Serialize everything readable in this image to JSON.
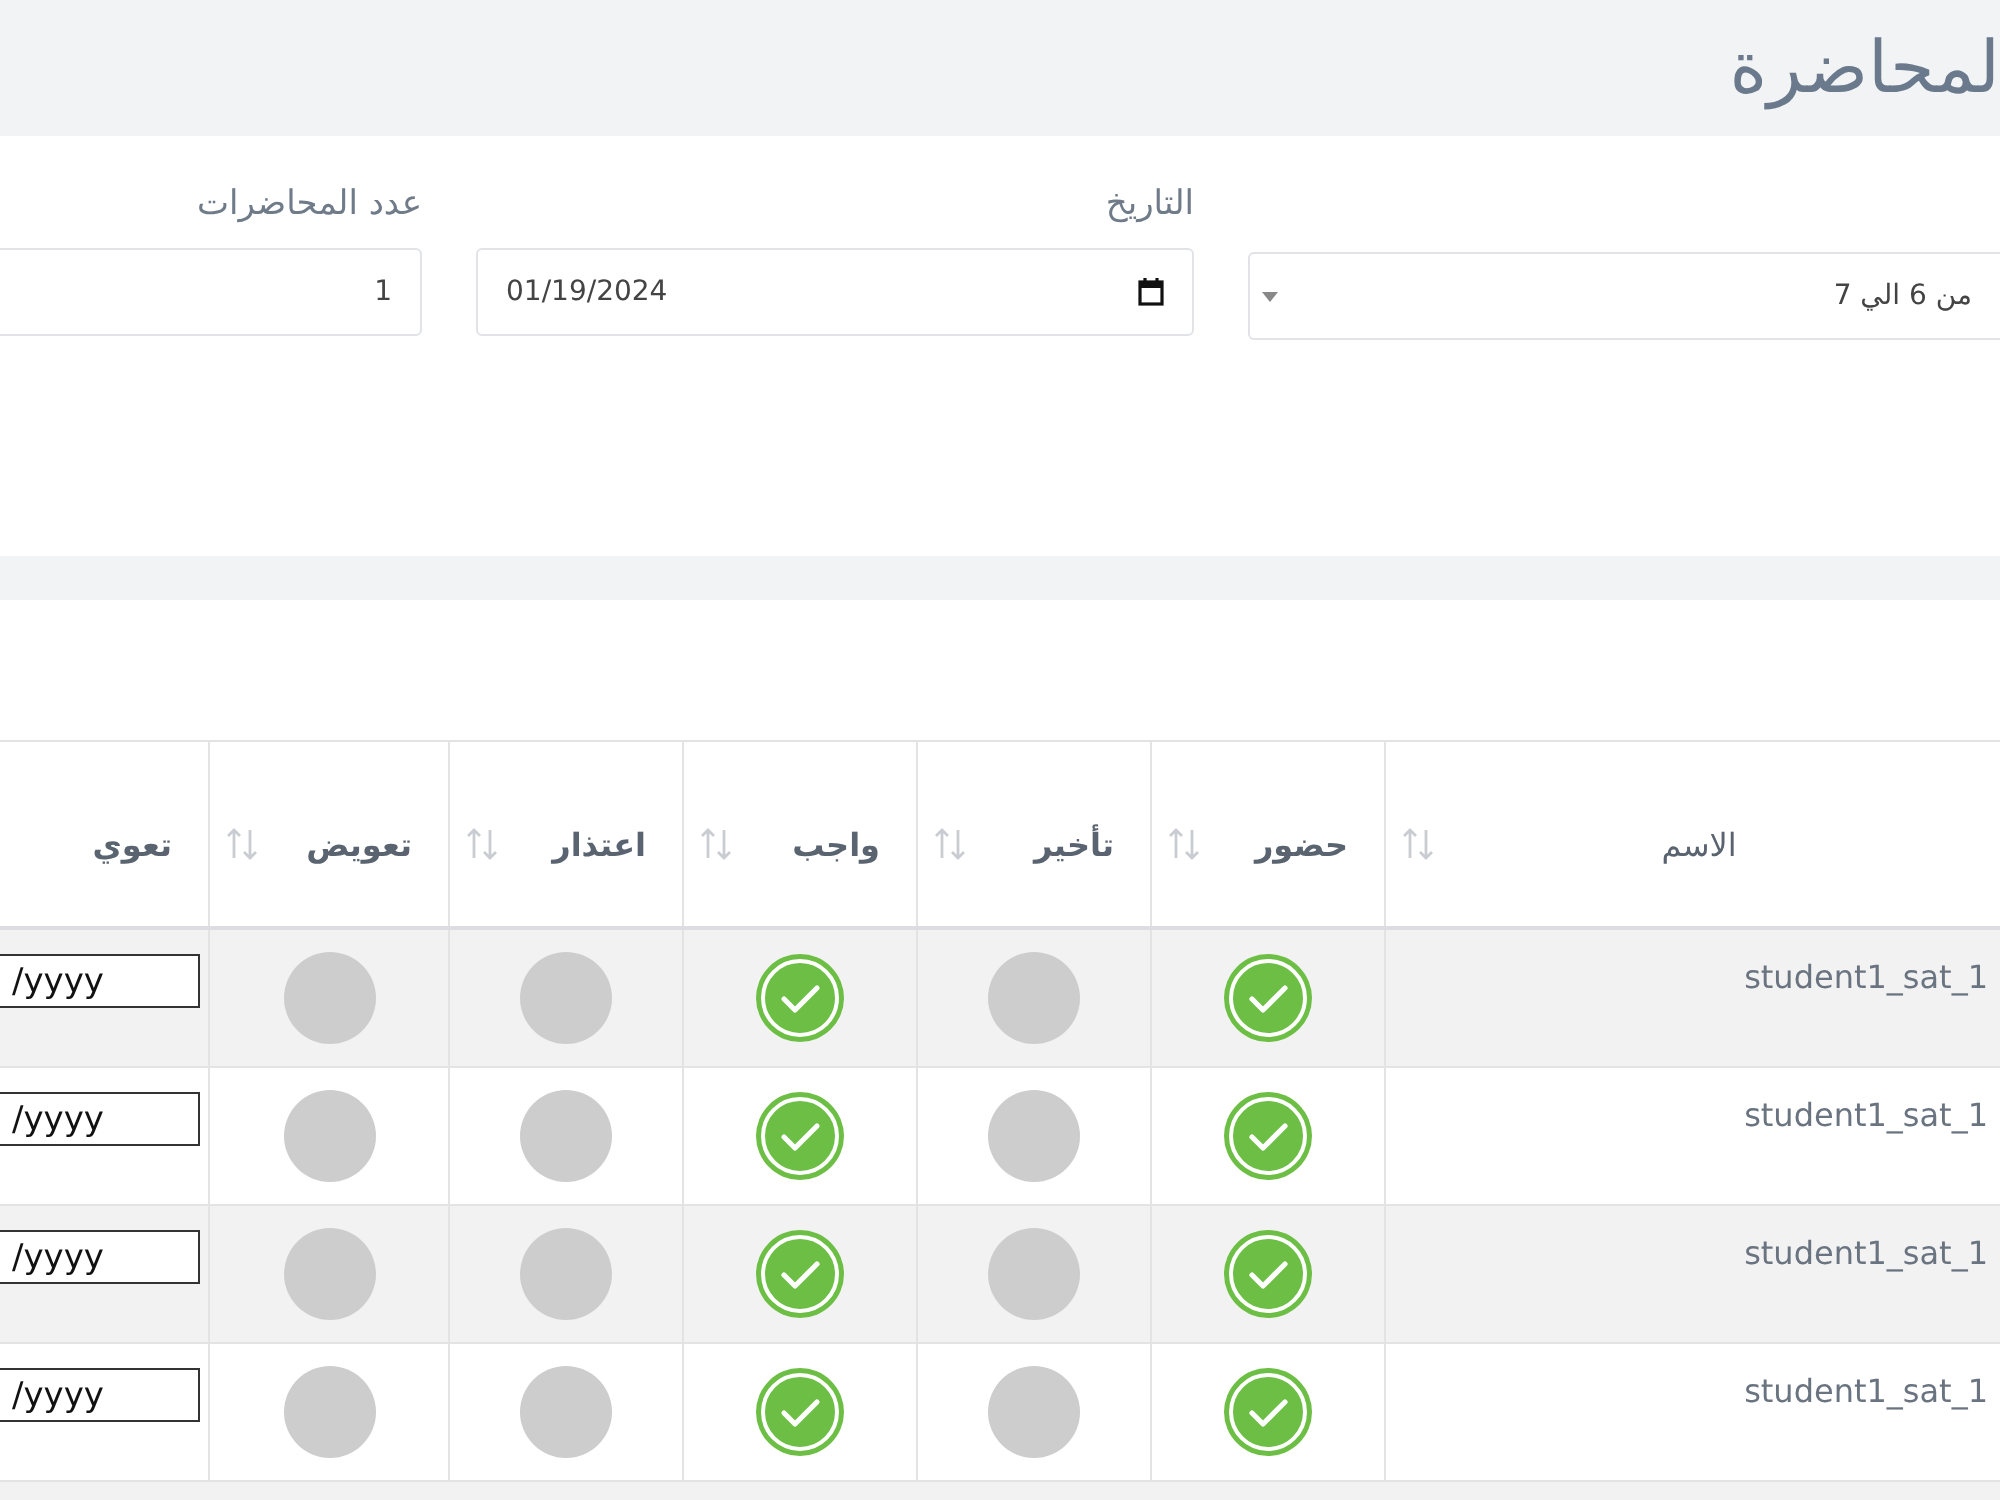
{
  "page_title": "لمحاضرة",
  "form": {
    "period_select": {
      "value": "من 6 الي 7"
    },
    "date": {
      "label": "التاريخ",
      "value": "01/19/2024"
    },
    "lecture_count": {
      "label": "عدد المحاضرات",
      "value": "1"
    }
  },
  "table": {
    "columns": [
      "الاسم",
      "حضور",
      "تأخير",
      "واجب",
      "اعتذار",
      "تعويض",
      "تعوي"
    ],
    "rows": [
      {
        "name": "student1_sat_1",
        "marks": [
          {
            "checked": true
          },
          {
            "checked": false
          },
          {
            "checked": true
          },
          {
            "checked": false
          },
          {
            "checked": false
          }
        ],
        "date_value": "/yyyy"
      },
      {
        "name": "student1_sat_1",
        "marks": [
          {
            "checked": true
          },
          {
            "checked": false
          },
          {
            "checked": true
          },
          {
            "checked": false
          },
          {
            "checked": false
          }
        ],
        "date_value": "/yyyy"
      },
      {
        "name": "student1_sat_1",
        "marks": [
          {
            "checked": true
          },
          {
            "checked": false
          },
          {
            "checked": true
          },
          {
            "checked": false
          },
          {
            "checked": false
          }
        ],
        "date_value": "/yyyy"
      },
      {
        "name": "student1_sat_1",
        "marks": [
          {
            "checked": true
          },
          {
            "checked": false
          },
          {
            "checked": true
          },
          {
            "checked": false
          },
          {
            "checked": false
          }
        ],
        "date_value": "/yyyy"
      }
    ]
  }
}
